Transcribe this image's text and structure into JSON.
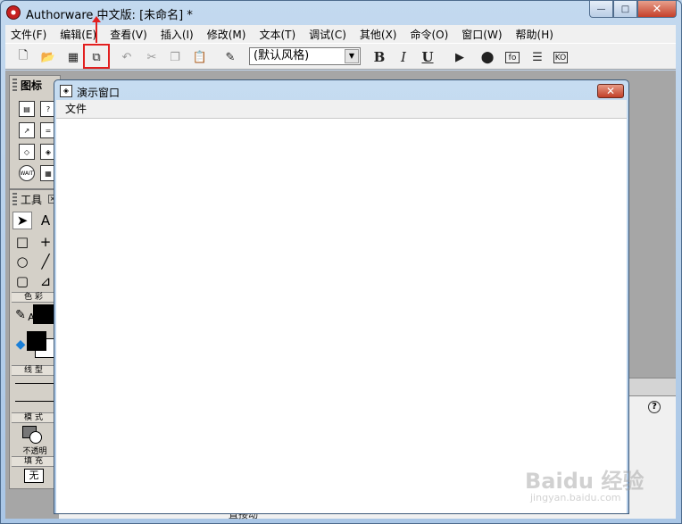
{
  "window": {
    "title": "Authorware 中文版: [未命名] *",
    "minimize": "—",
    "maximize": "□",
    "close": "✕"
  },
  "menubar": {
    "items": [
      "文件(F)",
      "编辑(E)",
      "查看(V)",
      "插入(I)",
      "修改(M)",
      "文本(T)",
      "调试(C)",
      "其他(X)",
      "命令(O)",
      "窗口(W)",
      "帮助(H)"
    ]
  },
  "toolbar": {
    "text_style": "(默认风格)",
    "bold": "B",
    "italic": "I",
    "underline": "U",
    "fo_button": "fo",
    "ko_button": "KO"
  },
  "icons_palette": {
    "title": "图标",
    "wait_icon": "WAIT"
  },
  "tools_palette": {
    "title": "工具",
    "close": "×",
    "text_tool": "A",
    "section_color": "色彩",
    "section_line": "线型",
    "section_mode": "模式",
    "mode_value": "不透明",
    "section_fill": "填充",
    "fill_value": "无"
  },
  "presentation_window": {
    "title": "演示窗口",
    "close": "✕",
    "menu_file": "文件"
  },
  "bottom_strip_text": "直接动",
  "watermark": {
    "brand": "Baidu 经验",
    "url": "jingyan.baidu.com"
  },
  "colors": {
    "highlight": "#e21f1f",
    "title_bar": "#c3d9ef",
    "workspace": "#a6a6a6"
  }
}
